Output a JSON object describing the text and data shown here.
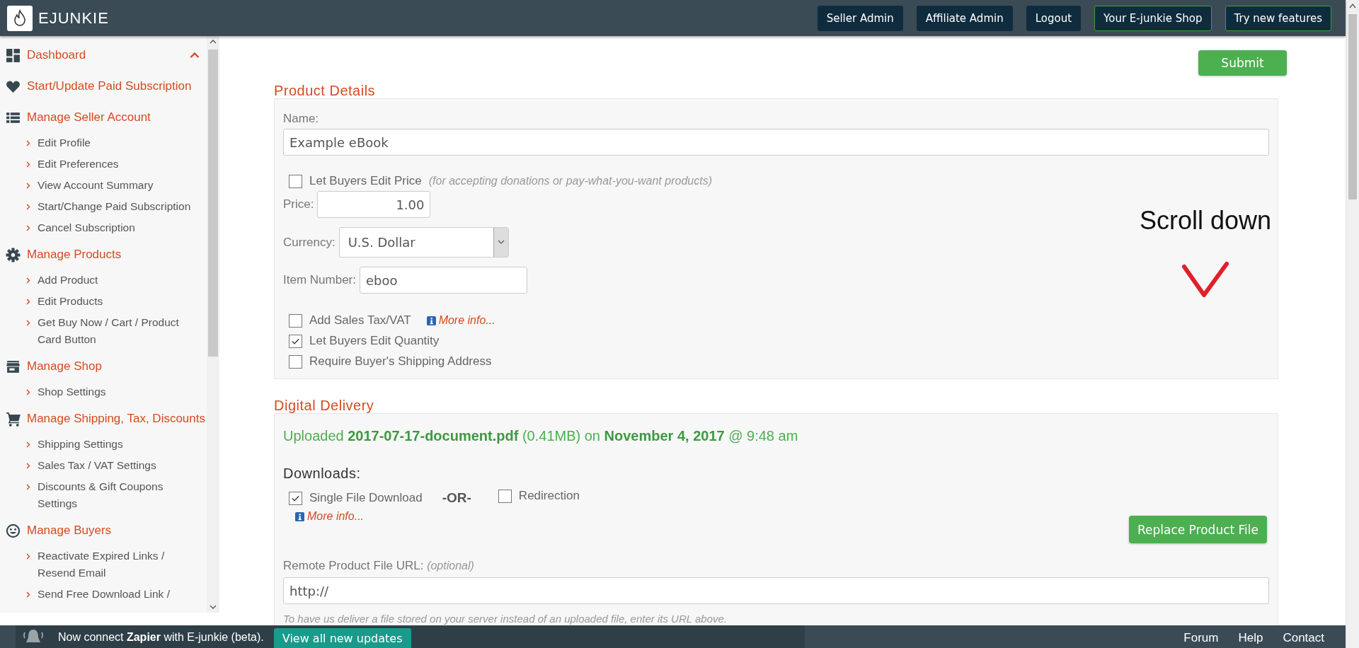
{
  "header": {
    "logo_text": "EJUNKIE",
    "buttons": [
      {
        "label": "Seller Admin",
        "kind": "dark"
      },
      {
        "label": "Affiliate Admin",
        "kind": "dark"
      },
      {
        "label": "Logout",
        "kind": "dark"
      },
      {
        "label": "Your E-junkie Shop",
        "kind": "outlined"
      },
      {
        "label": "Try new features",
        "kind": "outlined"
      }
    ]
  },
  "sidebar": {
    "items": [
      {
        "label": "Dashboard",
        "expanded": true
      },
      {
        "label": "Start/Update Paid Subscription",
        "expanded": false
      },
      {
        "label": "Manage Seller Account",
        "expanded": false,
        "children": [
          "Edit Profile",
          "Edit Preferences",
          "View Account Summary",
          "Start/Change Paid Subscription",
          "Cancel Subscription"
        ]
      },
      {
        "label": "Manage Products",
        "expanded": false,
        "children": [
          "Add Product",
          "Edit Products",
          "Get Buy Now / Cart / Product Card Button"
        ]
      },
      {
        "label": "Manage Shop",
        "expanded": false,
        "children": [
          "Shop Settings"
        ]
      },
      {
        "label": "Manage Shipping, Tax, Discounts",
        "expanded": false,
        "children": [
          "Shipping Settings",
          "Sales Tax / VAT Settings",
          "Discounts & Gift Coupons Settings"
        ]
      },
      {
        "label": "Manage Buyers",
        "expanded": false,
        "children": [
          "Reactivate Expired Links / Resend Email",
          "Send Free Download Link /"
        ]
      }
    ]
  },
  "submit_button": "Submit",
  "product_details": {
    "title": "Product Details",
    "name_label": "Name:",
    "name_value": "Example eBook",
    "edit_price": {
      "label": "Let Buyers Edit Price",
      "note": "(for accepting donations or pay-what-you-want products)",
      "checked": false
    },
    "price_label": "Price:",
    "price_value": "1.00",
    "currency_label": "Currency:",
    "currency_value": "U.S. Dollar",
    "item_number_label": "Item Number:",
    "item_number_value": "eboo",
    "options": [
      {
        "label": "Add Sales Tax/VAT",
        "checked": false,
        "more_info": "More info..."
      },
      {
        "label": "Let Buyers Edit Quantity",
        "checked": true
      },
      {
        "label": "Require Buyer's Shipping Address",
        "checked": false
      }
    ]
  },
  "annotation": {
    "text": "Scroll down"
  },
  "digital_delivery": {
    "title": "Digital Delivery",
    "upload_status": "Uploaded **2017-07-17-document.pdf** (0.41MB) on **November 4, 2017** @ 9:48 am",
    "downloads_label": "Downloads:",
    "single_file": {
      "label": "Single File Download",
      "checked": true
    },
    "or_label": "-OR-",
    "redirection": {
      "label": "Redirection",
      "checked": false
    },
    "more_info": "More info...",
    "replace_button": "Replace Product File",
    "remote_label": "Remote Product File URL:",
    "remote_note": "(optional)",
    "remote_value": "http://",
    "hint": "To have us deliver a file stored on your server instead of an uploaded file, enter its URL above."
  },
  "footer": {
    "notice": "Now connect **Zapier** with E-junkie (beta).",
    "updates_button": "View all new updates",
    "links": [
      "Forum",
      "Help",
      "Contact"
    ]
  }
}
